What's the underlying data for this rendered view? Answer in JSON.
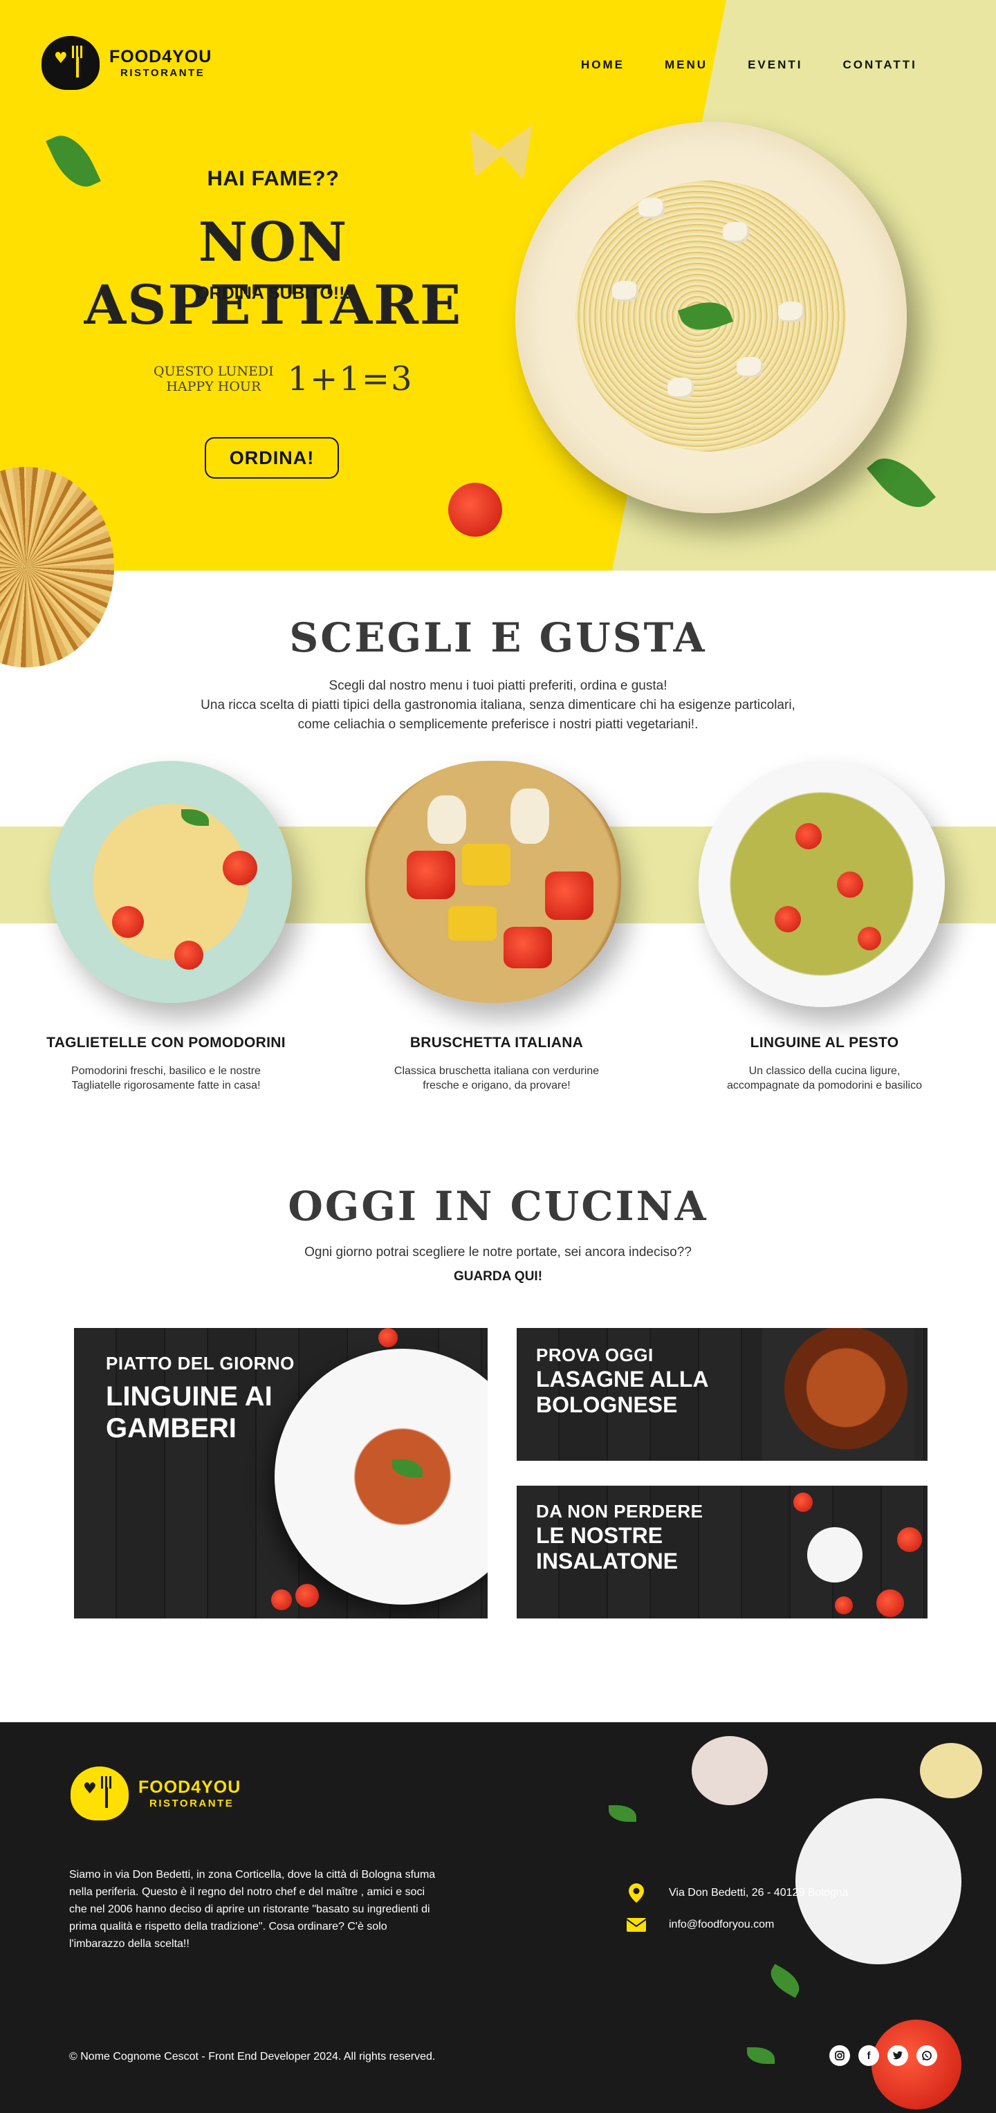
{
  "brand": {
    "name": "FOOD4YOU",
    "tagline": "RISTORANTE"
  },
  "nav": {
    "items": [
      "HOME",
      "MENU",
      "EVENTI",
      "CONTATTI"
    ]
  },
  "hero": {
    "question": "HAI FAME??",
    "headline": "NON ASPETTARE",
    "subline": "ORDINA SUBITO!!!",
    "promo_line1": "QUESTO LUNEDI",
    "promo_line2": "HAPPY HOUR",
    "promo_offer": "1+1=3",
    "cta": "ORDINA!"
  },
  "menu_section": {
    "title": "SCEGLI E GUSTA",
    "desc_line1": "Scegli dal nostro menu i tuoi piatti preferiti, ordina e gusta!",
    "desc_line2": "Una ricca scelta di piatti tipici della gastronomia italiana, senza dimenticare chi ha esigenze particolari,",
    "desc_line3": "come celiachia o semplicemente preferisce i nostri piatti vegetariani!.",
    "dishes": [
      {
        "name": "TAGLIETELLE CON POMODORINI",
        "desc1": "Pomodorini freschi, basilico e le nostre",
        "desc2": "Tagliatelle rigorosamente fatte in casa!"
      },
      {
        "name": "BRUSCHETTA ITALIANA",
        "desc1": "Classica bruschetta italiana con verdurine",
        "desc2": "fresche e origano, da provare!"
      },
      {
        "name": "LINGUINE AL PESTO",
        "desc1": "Un classico della cucina ligure,",
        "desc2": "accompagnate da pomodorini e basilico"
      }
    ]
  },
  "today_section": {
    "title": "OGGI IN CUCINA",
    "subtitle": "Ogni giorno potrai scegliere le notre portate, sei ancora indeciso??",
    "cta": "GUARDA QUI!",
    "cards": {
      "main": {
        "kicker": "PIATTO DEL GIORNO",
        "title1": "LINGUINE AI",
        "title2": "GAMBERI"
      },
      "lasagne": {
        "kicker": "PROVA OGGI",
        "title1": "LASAGNE ALLA",
        "title2": "BOLOGNESE"
      },
      "salads": {
        "kicker": "DA NON PERDERE",
        "title1": "LE NOSTRE",
        "title2": "INSALATONE"
      }
    }
  },
  "footer": {
    "about": "Siamo in via Don Bedetti, in zona Corticella, dove la città di Bologna sfuma nella periferia. Questo è il regno del notro chef  e del maître , amici e soci che nel 2006 hanno deciso di aprire un ristorante \"basato su ingredienti di prima qualità e rispetto della tradizione\". Cosa ordinare? C'è solo l'imbarazzo della scelta!!",
    "address": "Via Don Bedetti, 26 - 40129 Bologna",
    "email": "info@foodforyou.com",
    "copyright": "© Nome Cognome Cescot - Front End Developer 2024. All rights reserved.",
    "socials": [
      "instagram-icon",
      "facebook-icon",
      "twitter-icon",
      "whatsapp-icon"
    ]
  },
  "colors": {
    "yellow": "#FFE000",
    "light_olive": "#E8E6A0",
    "dark": "#1A1A1A"
  }
}
